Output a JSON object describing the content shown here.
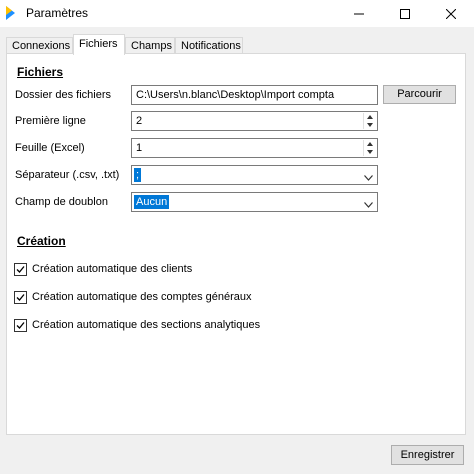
{
  "window": {
    "title": "Paramètres"
  },
  "tabs": [
    {
      "label": "Connexions",
      "active": false
    },
    {
      "label": "Fichiers",
      "active": true
    },
    {
      "label": "Champs",
      "active": false
    },
    {
      "label": "Notifications",
      "active": false
    }
  ],
  "fichiers": {
    "section_title": "Fichiers",
    "dossier_label": "Dossier des fichiers",
    "dossier_value": "C:\\Users\\n.blanc\\Desktop\\Import compta",
    "parcourir_label": "Parcourir",
    "premiere_ligne_label": "Première ligne",
    "premiere_ligne_value": "2",
    "feuille_label": "Feuille (Excel)",
    "feuille_value": "1",
    "separateur_label": "Séparateur (.csv, .txt)",
    "separateur_value": ";",
    "doublon_label": "Champ de doublon",
    "doublon_value": "Aucun"
  },
  "creation": {
    "section_title": "Création",
    "options": [
      {
        "label": "Création automatique des clients",
        "checked": true
      },
      {
        "label": "Création automatique des comptes généraux",
        "checked": true
      },
      {
        "label": "Création automatique des sections analytiques",
        "checked": true
      }
    ]
  },
  "footer": {
    "save_label": "Enregistrer"
  },
  "colors": {
    "accent": "#0078d7",
    "logo_blue": "#1e90ff",
    "logo_yellow": "#ffc000"
  }
}
